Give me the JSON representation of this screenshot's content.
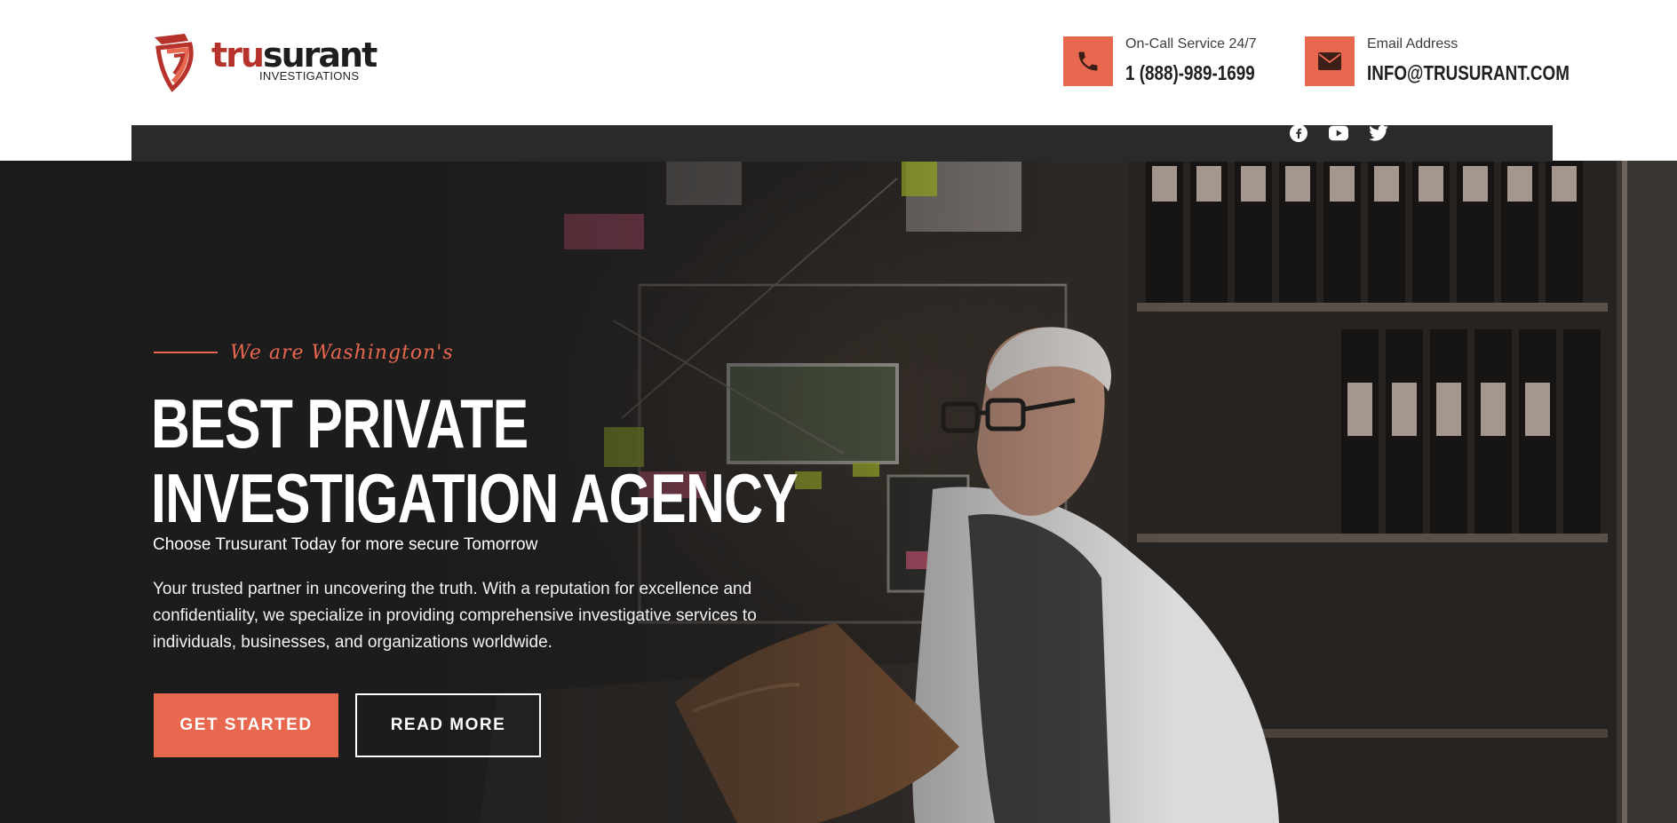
{
  "brand": {
    "logo_primary": "trusurant",
    "logo_secondary": "INVESTIGATIONS",
    "accent_color": "#e8674f",
    "logo_red": "#b6322a"
  },
  "header": {
    "phone": {
      "label": "On-Call Service 24/7",
      "value": "1 (888)-989-1699",
      "icon": "phone-icon"
    },
    "email": {
      "label": "Email Address",
      "value": "INFO@TRUSURANT.COM",
      "icon": "envelope-icon"
    }
  },
  "social": [
    {
      "name": "facebook",
      "icon": "facebook-icon"
    },
    {
      "name": "youtube",
      "icon": "youtube-icon"
    },
    {
      "name": "twitter",
      "icon": "twitter-icon"
    }
  ],
  "hero": {
    "kicker": "We are Washington's",
    "title_line1": "BEST PRIVATE",
    "title_line2": "INVESTIGATION AGENCY",
    "tagline": "Choose Trusurant Today for more secure Tomorrow",
    "description": "Your trusted partner in uncovering the truth. With a reputation for excellence and confidentiality, we specialize in providing comprehensive investigative services to individuals, businesses, and organizations worldwide.",
    "cta_primary": "GET STARTED",
    "cta_secondary": "READ MORE",
    "background_image": "investigator-reading-file-in-evidence-room"
  }
}
